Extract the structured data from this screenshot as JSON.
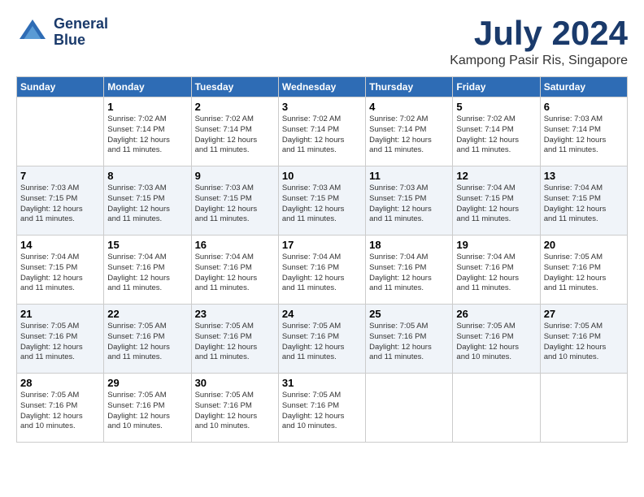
{
  "header": {
    "logo_line1": "General",
    "logo_line2": "Blue",
    "month_year": "July 2024",
    "location": "Kampong Pasir Ris, Singapore"
  },
  "weekdays": [
    "Sunday",
    "Monday",
    "Tuesday",
    "Wednesday",
    "Thursday",
    "Friday",
    "Saturday"
  ],
  "weeks": [
    [
      {
        "day": "",
        "info": ""
      },
      {
        "day": "1",
        "info": "Sunrise: 7:02 AM\nSunset: 7:14 PM\nDaylight: 12 hours\nand 11 minutes."
      },
      {
        "day": "2",
        "info": "Sunrise: 7:02 AM\nSunset: 7:14 PM\nDaylight: 12 hours\nand 11 minutes."
      },
      {
        "day": "3",
        "info": "Sunrise: 7:02 AM\nSunset: 7:14 PM\nDaylight: 12 hours\nand 11 minutes."
      },
      {
        "day": "4",
        "info": "Sunrise: 7:02 AM\nSunset: 7:14 PM\nDaylight: 12 hours\nand 11 minutes."
      },
      {
        "day": "5",
        "info": "Sunrise: 7:02 AM\nSunset: 7:14 PM\nDaylight: 12 hours\nand 11 minutes."
      },
      {
        "day": "6",
        "info": "Sunrise: 7:03 AM\nSunset: 7:14 PM\nDaylight: 12 hours\nand 11 minutes."
      }
    ],
    [
      {
        "day": "7",
        "info": "Sunrise: 7:03 AM\nSunset: 7:15 PM\nDaylight: 12 hours\nand 11 minutes."
      },
      {
        "day": "8",
        "info": "Sunrise: 7:03 AM\nSunset: 7:15 PM\nDaylight: 12 hours\nand 11 minutes."
      },
      {
        "day": "9",
        "info": "Sunrise: 7:03 AM\nSunset: 7:15 PM\nDaylight: 12 hours\nand 11 minutes."
      },
      {
        "day": "10",
        "info": "Sunrise: 7:03 AM\nSunset: 7:15 PM\nDaylight: 12 hours\nand 11 minutes."
      },
      {
        "day": "11",
        "info": "Sunrise: 7:03 AM\nSunset: 7:15 PM\nDaylight: 12 hours\nand 11 minutes."
      },
      {
        "day": "12",
        "info": "Sunrise: 7:04 AM\nSunset: 7:15 PM\nDaylight: 12 hours\nand 11 minutes."
      },
      {
        "day": "13",
        "info": "Sunrise: 7:04 AM\nSunset: 7:15 PM\nDaylight: 12 hours\nand 11 minutes."
      }
    ],
    [
      {
        "day": "14",
        "info": "Sunrise: 7:04 AM\nSunset: 7:15 PM\nDaylight: 12 hours\nand 11 minutes."
      },
      {
        "day": "15",
        "info": "Sunrise: 7:04 AM\nSunset: 7:16 PM\nDaylight: 12 hours\nand 11 minutes."
      },
      {
        "day": "16",
        "info": "Sunrise: 7:04 AM\nSunset: 7:16 PM\nDaylight: 12 hours\nand 11 minutes."
      },
      {
        "day": "17",
        "info": "Sunrise: 7:04 AM\nSunset: 7:16 PM\nDaylight: 12 hours\nand 11 minutes."
      },
      {
        "day": "18",
        "info": "Sunrise: 7:04 AM\nSunset: 7:16 PM\nDaylight: 12 hours\nand 11 minutes."
      },
      {
        "day": "19",
        "info": "Sunrise: 7:04 AM\nSunset: 7:16 PM\nDaylight: 12 hours\nand 11 minutes."
      },
      {
        "day": "20",
        "info": "Sunrise: 7:05 AM\nSunset: 7:16 PM\nDaylight: 12 hours\nand 11 minutes."
      }
    ],
    [
      {
        "day": "21",
        "info": "Sunrise: 7:05 AM\nSunset: 7:16 PM\nDaylight: 12 hours\nand 11 minutes."
      },
      {
        "day": "22",
        "info": "Sunrise: 7:05 AM\nSunset: 7:16 PM\nDaylight: 12 hours\nand 11 minutes."
      },
      {
        "day": "23",
        "info": "Sunrise: 7:05 AM\nSunset: 7:16 PM\nDaylight: 12 hours\nand 11 minutes."
      },
      {
        "day": "24",
        "info": "Sunrise: 7:05 AM\nSunset: 7:16 PM\nDaylight: 12 hours\nand 11 minutes."
      },
      {
        "day": "25",
        "info": "Sunrise: 7:05 AM\nSunset: 7:16 PM\nDaylight: 12 hours\nand 11 minutes."
      },
      {
        "day": "26",
        "info": "Sunrise: 7:05 AM\nSunset: 7:16 PM\nDaylight: 12 hours\nand 10 minutes."
      },
      {
        "day": "27",
        "info": "Sunrise: 7:05 AM\nSunset: 7:16 PM\nDaylight: 12 hours\nand 10 minutes."
      }
    ],
    [
      {
        "day": "28",
        "info": "Sunrise: 7:05 AM\nSunset: 7:16 PM\nDaylight: 12 hours\nand 10 minutes."
      },
      {
        "day": "29",
        "info": "Sunrise: 7:05 AM\nSunset: 7:16 PM\nDaylight: 12 hours\nand 10 minutes."
      },
      {
        "day": "30",
        "info": "Sunrise: 7:05 AM\nSunset: 7:16 PM\nDaylight: 12 hours\nand 10 minutes."
      },
      {
        "day": "31",
        "info": "Sunrise: 7:05 AM\nSunset: 7:16 PM\nDaylight: 12 hours\nand 10 minutes."
      },
      {
        "day": "",
        "info": ""
      },
      {
        "day": "",
        "info": ""
      },
      {
        "day": "",
        "info": ""
      }
    ]
  ]
}
